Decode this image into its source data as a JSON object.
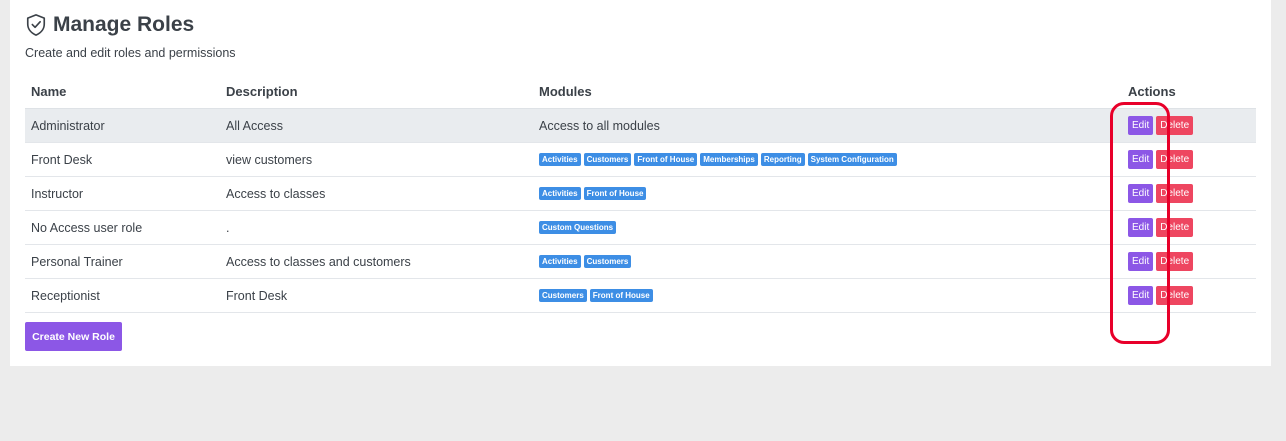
{
  "header": {
    "title": "Manage Roles",
    "subtitle": "Create and edit roles and permissions"
  },
  "table": {
    "columns": [
      "Name",
      "Description",
      "Modules",
      "Actions"
    ],
    "rows": [
      {
        "name": "Administrator",
        "description": "All Access",
        "modules_text": "Access to all modules",
        "modules": []
      },
      {
        "name": "Front Desk",
        "description": "view customers",
        "modules_text": "",
        "modules": [
          "Activities",
          "Customers",
          "Front of House",
          "Memberships",
          "Reporting",
          "System Configuration"
        ]
      },
      {
        "name": "Instructor",
        "description": "Access to classes",
        "modules_text": "",
        "modules": [
          "Activities",
          "Front of House"
        ]
      },
      {
        "name": "No Access user role",
        "description": ".",
        "modules_text": "",
        "modules": [
          "Custom Questions"
        ]
      },
      {
        "name": "Personal Trainer",
        "description": "Access to classes and customers",
        "modules_text": "",
        "modules": [
          "Activities",
          "Customers"
        ]
      },
      {
        "name": "Receptionist",
        "description": "Front Desk",
        "modules_text": "",
        "modules": [
          "Customers",
          "Front of House"
        ]
      }
    ],
    "edit_label": "Edit",
    "delete_label": "Delete"
  },
  "create_button_label": "Create New Role",
  "icons": {
    "title_icon": "shield-check-icon"
  },
  "colors": {
    "accent": "#8c57e6",
    "danger": "#ee4660",
    "badge": "#3d8ee5",
    "highlight": "#e8002a"
  }
}
